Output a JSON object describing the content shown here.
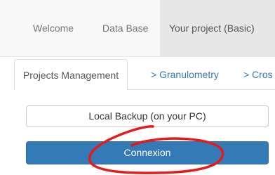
{
  "navbar": {
    "items": [
      {
        "label": "Welcome"
      },
      {
        "label": "Data Base"
      },
      {
        "label": "Your project (Basic)"
      }
    ]
  },
  "tabs": [
    {
      "label": "Projects Management"
    },
    {
      "label": "> Granulometry"
    },
    {
      "label": "> Cros"
    }
  ],
  "buttons": {
    "backup_label": "Local Backup (on your PC)",
    "connexion_label": "Connexion"
  },
  "colors": {
    "primary": "#337ab7",
    "annotation": "#e31b1b"
  }
}
